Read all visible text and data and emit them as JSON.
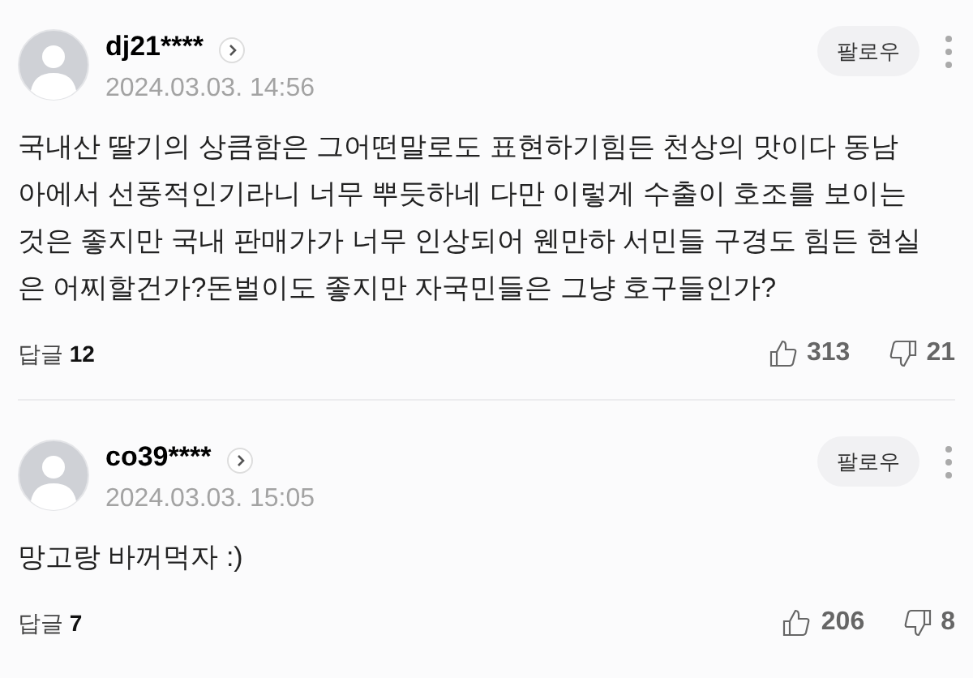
{
  "comments": [
    {
      "username": "dj21****",
      "date": "2024.03.03. 14:56",
      "follow_label": "팔로우",
      "body": "국내산 딸기의 상큼함은 그어떤말로도 표현하기힘든 천상의 맛이다 동남아에서 선풍적인기라니 너무 뿌듯하네 다만 이렇게 수출이 호조를 보이는것은 좋지만 국내 판매가가 너무 인상되어 웬만하 서민들 구경도 힘든 현실은 어찌할건가?돈벌이도 좋지만 자국민들은 그냥 호구들인가?",
      "reply_label": "답글",
      "reply_count": "12",
      "likes": "313",
      "dislikes": "21"
    },
    {
      "username": "co39****",
      "date": "2024.03.03. 15:05",
      "follow_label": "팔로우",
      "body": "망고랑 바꺼먹자 :)",
      "reply_label": "답글",
      "reply_count": "7",
      "likes": "206",
      "dislikes": "8"
    }
  ]
}
